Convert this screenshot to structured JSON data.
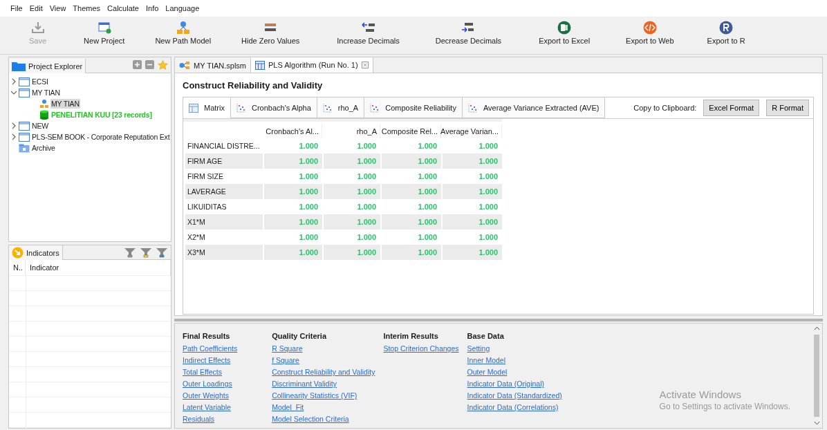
{
  "menu": [
    "File",
    "Edit",
    "View",
    "Themes",
    "Calculate",
    "Info",
    "Language"
  ],
  "toolbar": [
    {
      "kind": "save",
      "label": "Save",
      "disabled": true
    },
    {
      "kind": "new-project",
      "label": "New Project",
      "disabled": false
    },
    {
      "kind": "new-model",
      "label": "New Path Model",
      "disabled": false
    },
    {
      "kind": "zero",
      "label": "Hide Zero Values",
      "disabled": false
    },
    {
      "kind": "increase",
      "label": "Increase Decimals",
      "disabled": false
    },
    {
      "kind": "decrease",
      "label": "Decrease Decimals",
      "disabled": false
    },
    {
      "kind": "excel",
      "label": "Export to Excel",
      "disabled": false
    },
    {
      "kind": "web",
      "label": "Export to Web",
      "disabled": false
    },
    {
      "kind": "r",
      "label": "Export to R",
      "disabled": false
    }
  ],
  "project_explorer": {
    "title": "Project Explorer",
    "items": [
      {
        "kind": "project",
        "label": "ECSI",
        "expanded": false,
        "selected": false
      },
      {
        "kind": "project",
        "label": "MY TIAN",
        "expanded": true,
        "selected": false,
        "children": [
          {
            "kind": "model",
            "label": "MY TIAN",
            "selected": true
          },
          {
            "kind": "dataset",
            "label": "PENELITIAN KUU [23 records]",
            "selected": false
          }
        ]
      },
      {
        "kind": "project",
        "label": "NEW",
        "expanded": false,
        "selected": false
      },
      {
        "kind": "project",
        "label": "PLS-SEM BOOK - Corporate Reputation Ext",
        "expanded": false,
        "selected": false
      },
      {
        "kind": "archive",
        "label": "Archive",
        "selected": false
      }
    ]
  },
  "indicators": {
    "title": "Indicators",
    "columns": [
      "N..",
      "Indicator"
    ]
  },
  "editor_tabs": [
    {
      "kind": "model",
      "label": "MY TIAN.splsm",
      "selected": false,
      "closable": false
    },
    {
      "kind": "report",
      "label": "PLS Algorithm (Run No. 1)",
      "selected": true,
      "closable": true
    }
  ],
  "report": {
    "title": "Construct Reliability and Validity",
    "tabs": [
      {
        "kind": "matrix",
        "label": "Matrix",
        "selected": true
      },
      {
        "kind": "chart",
        "label": "Cronbach's Alpha",
        "selected": false
      },
      {
        "kind": "chart",
        "label": "rho_A",
        "selected": false
      },
      {
        "kind": "chart",
        "label": "Composite Reliability",
        "selected": false
      },
      {
        "kind": "chart",
        "label": "Average Variance Extracted (AVE)",
        "selected": false
      }
    ],
    "clipboard_label": "Copy to Clipboard:",
    "clipboard_buttons": [
      "Excel Format",
      "R Format"
    ],
    "table": {
      "columns": [
        "Cronbach's Al...",
        "rho_A",
        "Composite Rel...",
        "Average Varian..."
      ],
      "rows": [
        {
          "label": "FINANCIAL DISTRE...",
          "values": [
            "1.000",
            "1.000",
            "1.000",
            "1.000"
          ]
        },
        {
          "label": "FIRM AGE",
          "values": [
            "1.000",
            "1.000",
            "1.000",
            "1.000"
          ]
        },
        {
          "label": "FIRM SIZE",
          "values": [
            "1.000",
            "1.000",
            "1.000",
            "1.000"
          ]
        },
        {
          "label": "LAVERAGE",
          "values": [
            "1.000",
            "1.000",
            "1.000",
            "1.000"
          ]
        },
        {
          "label": "LIKUIDITAS",
          "values": [
            "1.000",
            "1.000",
            "1.000",
            "1.000"
          ]
        },
        {
          "label": "X1*M",
          "values": [
            "1.000",
            "1.000",
            "1.000",
            "1.000"
          ]
        },
        {
          "label": "X2*M",
          "values": [
            "1.000",
            "1.000",
            "1.000",
            "1.000"
          ]
        },
        {
          "label": "X3*M",
          "values": [
            "1.000",
            "1.000",
            "1.000",
            "1.000"
          ]
        }
      ]
    }
  },
  "result_links": [
    {
      "heading": "Final Results",
      "links": [
        "Path Coefficients",
        "Indirect Effects",
        "Total Effects",
        "Outer Loadings",
        "Outer Weights",
        "Latent Variable",
        "Residuals"
      ]
    },
    {
      "heading": "Quality Criteria",
      "links": [
        "R Square",
        "f Square",
        "Construct Reliability and Validity",
        "Discriminant Validity",
        "Collinearity Statistics (VIF)",
        "Model_Fit",
        "Model Selection Criteria"
      ]
    },
    {
      "heading": "Interim Results",
      "links": [
        "Stop Criterion Changes"
      ]
    },
    {
      "heading": "Base Data",
      "links": [
        "Setting",
        "Inner Model",
        "Outer Model",
        "Indicator Data (Original)",
        "Indicator Data (Standardized)",
        "Indicator Data (Correlations)"
      ]
    }
  ],
  "activation_notice": {
    "title": "Activate Windows",
    "message": "Go to Settings to activate Windows."
  }
}
